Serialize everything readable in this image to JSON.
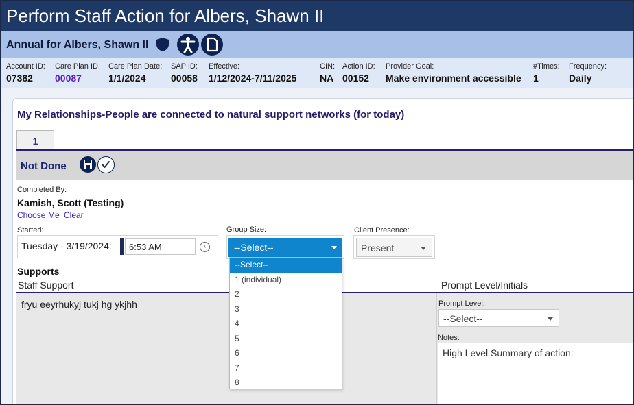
{
  "window": {
    "title": "Perform Staff Action for Albers, Shawn II"
  },
  "subheader": {
    "title": "Annual for Albers, Shawn II"
  },
  "info": [
    {
      "label": "Account ID:",
      "value": "07382"
    },
    {
      "label": "Care Plan ID:",
      "value": "00087"
    },
    {
      "label": "Care Plan Date:",
      "value": "1/1/2024"
    },
    {
      "label": "SAP ID:",
      "value": "00058"
    },
    {
      "label": "Effective:",
      "value": "1/12/2024-7/11/2025"
    },
    {
      "label": "CIN:",
      "value": "NA"
    },
    {
      "label": "Action ID:",
      "value": "00152"
    },
    {
      "label": "Provider Goal:",
      "value": "Make environment accessible"
    },
    {
      "label": "#Times:",
      "value": "1"
    },
    {
      "label": "Frequency:",
      "value": "Daily"
    }
  ],
  "goal_title": "My Relationships-People are connected to natural support networks (for today)",
  "tabs": [
    {
      "label": "1"
    }
  ],
  "status": {
    "text": "Not Done"
  },
  "completed_by": {
    "label": "Completed By:",
    "name": "Kamish, Scott (Testing)",
    "actions": {
      "choose": "Choose",
      "me": "Me",
      "clear": "Clear"
    }
  },
  "started": {
    "label": "Started:",
    "date": "Tuesday - 3/19/2024:",
    "time": "6:53 AM"
  },
  "group_size": {
    "label": "Group Size:",
    "selected": "--Select--",
    "options": [
      "--Select--",
      "1 (individual)",
      "2",
      "3",
      "4",
      "5",
      "6",
      "7",
      "8"
    ]
  },
  "client_presence": {
    "label": "Client Presence:",
    "selected": "Present"
  },
  "supports": {
    "heading": "Supports",
    "staff_support_label": "Staff Support",
    "staff_support_text": "fryu eeyrhukyj tukj hg ykjhh",
    "prompt_level_initials_label": "Prompt Level/Initials",
    "prompt_level_label": "Prompt Level:",
    "prompt_level_selected": "--Select--",
    "notes_label": "Notes:",
    "notes_text": "High Level Summary of action:"
  },
  "icons": {
    "shield": "shield-icon",
    "person": "accessibility-person-icon",
    "document": "document-icon",
    "save": "save-disk-icon",
    "check": "checkmark-icon",
    "clock": "clock-icon",
    "caret": "chevron-down-icon"
  },
  "colors": {
    "title_bar": "#1e3966",
    "subheader_bar": "#a8c0e8",
    "info_bar": "#dfe8f6",
    "accent_blue": "#0e85cd",
    "link_purple": "#5b1fc9",
    "dark_navy": "#0d2250"
  }
}
